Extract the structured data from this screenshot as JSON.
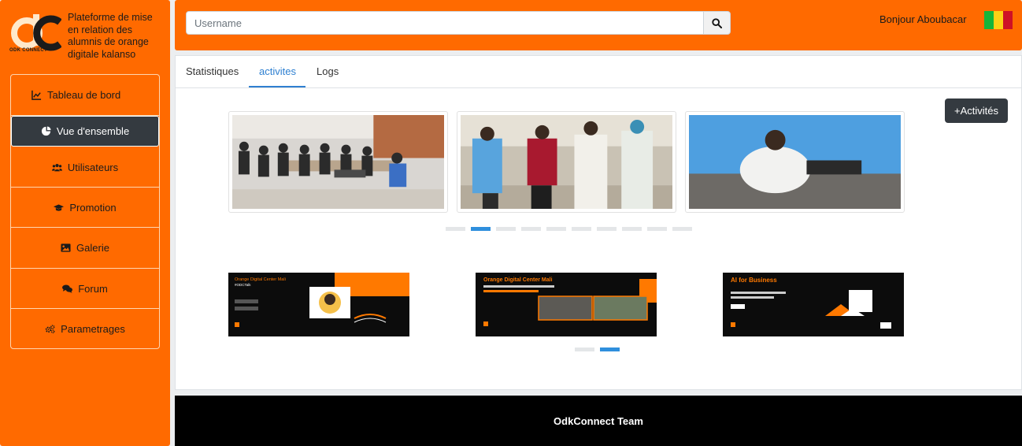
{
  "brand": {
    "logo_text": "ODK CONNECT",
    "title": "Plateforme de mise en relation des alumnis de orange digitale kalanso"
  },
  "sidebar": {
    "items": [
      {
        "label": "Tableau de bord",
        "icon": "chart-line-icon"
      },
      {
        "label": "Vue d'ensemble",
        "icon": "pie-chart-icon",
        "active": true
      },
      {
        "label": "Utilisateurs",
        "icon": "users-icon"
      },
      {
        "label": "Promotion",
        "icon": "graduation-cap-icon"
      },
      {
        "label": "Galerie",
        "icon": "image-icon"
      },
      {
        "label": "Forum",
        "icon": "comments-icon"
      },
      {
        "label": "Parametrages",
        "icon": "cogs-icon"
      }
    ]
  },
  "header": {
    "search_placeholder": "Username",
    "search_icon": "search-icon",
    "greeting": "Bonjour Aboubacar",
    "flag_colors": [
      "#14b53a",
      "#fcd116",
      "#ce1126"
    ]
  },
  "tabs": [
    {
      "label": "Statistiques"
    },
    {
      "label": "activites",
      "active": true
    },
    {
      "label": "Logs"
    }
  ],
  "actions": {
    "add_label": "+Activités"
  },
  "carousel_photos": {
    "slide_count": 10,
    "active_index": 1
  },
  "carousel_posters": {
    "slide_count": 2,
    "active_index": 1,
    "posters": [
      {
        "title": "Orange Digital Center Mali",
        "subtitle": "#ODCTalk"
      },
      {
        "title": "Orange Digital Center Mali",
        "subtitle": ""
      },
      {
        "title": "AI for Business",
        "subtitle": ""
      }
    ]
  },
  "footer": {
    "text": "OdkConnect Team"
  },
  "colors": {
    "primary": "#ff6a00",
    "dark": "#343a40",
    "accent": "#2f80d1"
  }
}
